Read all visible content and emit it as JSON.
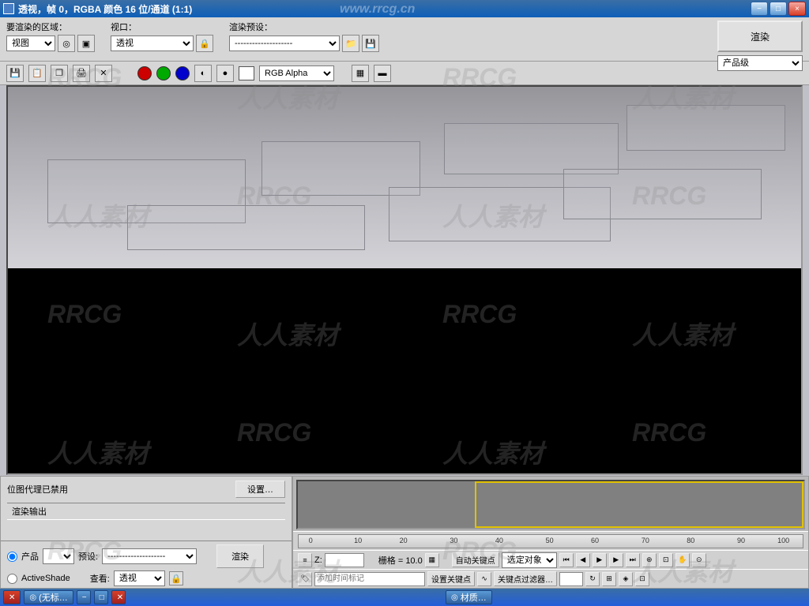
{
  "titlebar": {
    "text": "透视，帧 0，RGBA 颜色 16 位/通道 (1:1)"
  },
  "toolbar": {
    "area_label": "要渲染的区域：",
    "area_value": "视图",
    "viewport_label": "视口：",
    "viewport_value": "透视",
    "preset_label": "渲染预设：",
    "preset_value": "--------------------",
    "render_btn": "渲染",
    "render_mode": "产品级"
  },
  "channelbar": {
    "channel_select": "RGB Alpha"
  },
  "panel": {
    "bitmap_proxy": "位图代理已禁用",
    "settings_btn": "设置…",
    "output_title": "渲染输出",
    "prod_radio": "产品",
    "preset_lbl": "预设:",
    "preset_val": "--------------------",
    "activeshade": "ActiveShade",
    "view_lbl": "查看:",
    "view_val": "透视",
    "render_small": "渲染"
  },
  "timeline": {
    "z_label": "Z:",
    "grid_label": "栅格 = 10.0",
    "autokey": "自动关键点",
    "selobj": "选定对象",
    "setkey": "设置关键点",
    "keyfilter": "关键点过滤器…",
    "addtime": "添加时间标记",
    "ticks": [
      "0",
      "10",
      "20",
      "30",
      "40",
      "50",
      "60",
      "70",
      "80",
      "90",
      "100"
    ]
  },
  "taskbar": {
    "app1": "(无标…",
    "app2": "材质…"
  },
  "watermark": {
    "rrcg": "RRCG",
    "cn": "人人素材",
    "url": "www.rrcg.cn"
  }
}
